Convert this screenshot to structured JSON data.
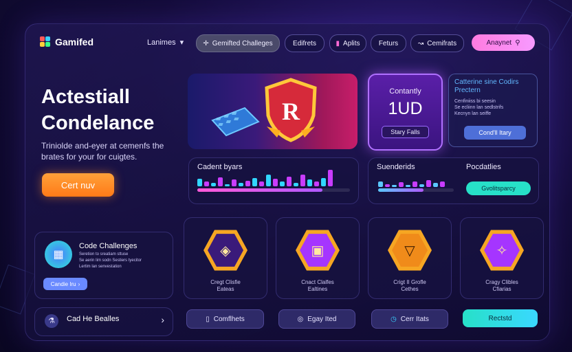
{
  "header": {
    "logo_text": "Gamifed",
    "nav_dropdown": "Lanimes",
    "tabs": [
      "Gemifted Challeges",
      "Edifrets",
      "Aplits",
      "Feturs",
      "Cemifrats"
    ],
    "search_label": "Anaynet"
  },
  "hero": {
    "title_line1": "Actestiall",
    "title_line2": "Condelance",
    "subtitle": "Triniolde and-eyer at cemenfs the brates for your for cuigtes.",
    "cta": "Cert nuv"
  },
  "promo": {
    "heading": "Contantly",
    "value": "1UD",
    "button": "Stary Falls"
  },
  "info_card": {
    "title": "Catterine sine Codirs Prectern",
    "lines": [
      "Cenfiniiss bi seesin",
      "Se ecliinn lan sedlstrifs",
      "Kecnyn lan seiffe"
    ],
    "button": "Cond'll Itary"
  },
  "stats_left": {
    "title": "Cadent byars",
    "progress": 0.82,
    "bars": [
      0.45,
      0.3,
      0.2,
      0.55,
      0.1,
      0.4,
      0.2,
      0.35,
      0.5,
      0.3,
      0.7,
      0.45,
      0.3,
      0.6,
      0.2,
      0.7,
      0.4,
      0.3,
      0.5,
      1.0
    ],
    "bar_colors": [
      "#31d6ff",
      "#c93cff",
      "#31d6ff",
      "#c93cff"
    ]
  },
  "stats_right": {
    "title": "Suenderids",
    "title2": "Pocdatlies",
    "progress": 0.6,
    "bars": [
      0.6,
      0.3,
      0.2,
      0.5,
      0.2,
      0.6,
      0.3,
      0.7,
      0.4,
      0.6
    ],
    "button": "Gvolitsparcy"
  },
  "side_card": {
    "title": "Code Challenges",
    "lines": [
      "Seretion to sreatiam sttuse",
      "Se aerin Iim sodn Sestiers tyecitor",
      "Lertim lan senvestation"
    ],
    "button": "Candie Iru"
  },
  "hex_cards": [
    {
      "label1": "Cregt Clisfie",
      "label2": "Eateas",
      "icon": "shield-icon",
      "color": "#f6a623"
    },
    {
      "label1": "Cnact Clalfes",
      "label2": "Ealtines",
      "icon": "cube-icon",
      "color": "#a535ff"
    },
    {
      "label1": "Crigt II Grofle",
      "label2": "Cethes",
      "icon": "trophy-icon",
      "color": "#f6a623"
    },
    {
      "label1": "Cragy Clibles",
      "label2": "Cfiarias",
      "icon": "star-icon",
      "color": "#a535ff"
    }
  ],
  "bottom": {
    "side_label": "Cad He Bealles",
    "buttons": [
      "Comflhets",
      "Egay Ited",
      "Cerr Itats",
      "Rectstd"
    ]
  },
  "colors": {
    "accent_orange": "#ff8a24",
    "accent_pink": "#f48cf0",
    "accent_cyan": "#2ee6d6",
    "accent_purple": "#a535ff"
  }
}
